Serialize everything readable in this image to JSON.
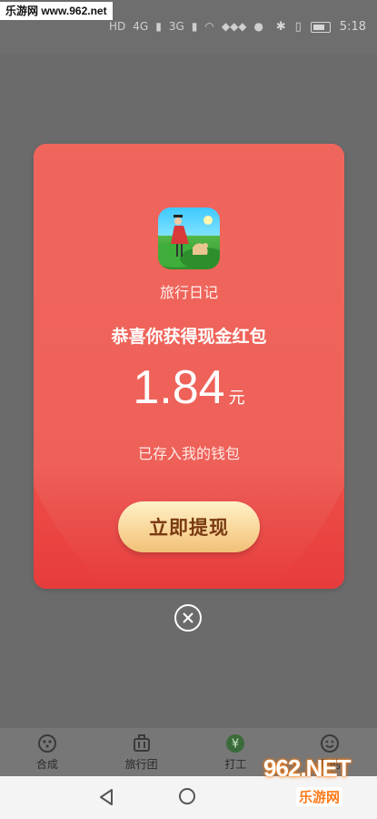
{
  "status_bar": {
    "watermark": "乐游网 www.962.net",
    "network_labels": [
      "HD",
      "4G",
      "3G"
    ],
    "time": "5:18"
  },
  "dialog": {
    "app_name": "旅行日记",
    "headline": "恭喜你获得现金红包",
    "amount": "1.84",
    "unit": "元",
    "note": "已存入我的钱包",
    "withdraw_label": "立即提现",
    "colors": {
      "card_top": "#f06a60",
      "card_bottom": "#e73c3c",
      "button": "#f9d79a"
    }
  },
  "tabs": [
    {
      "label": "合成",
      "icon": "face-dots-icon"
    },
    {
      "label": "旅行团",
      "icon": "luggage-icon"
    },
    {
      "label": "打工",
      "icon": "yen-coin-icon"
    },
    {
      "label": "我的",
      "icon": "smiley-icon"
    }
  ],
  "brand": {
    "big": "962.NET",
    "small": "乐游网"
  }
}
